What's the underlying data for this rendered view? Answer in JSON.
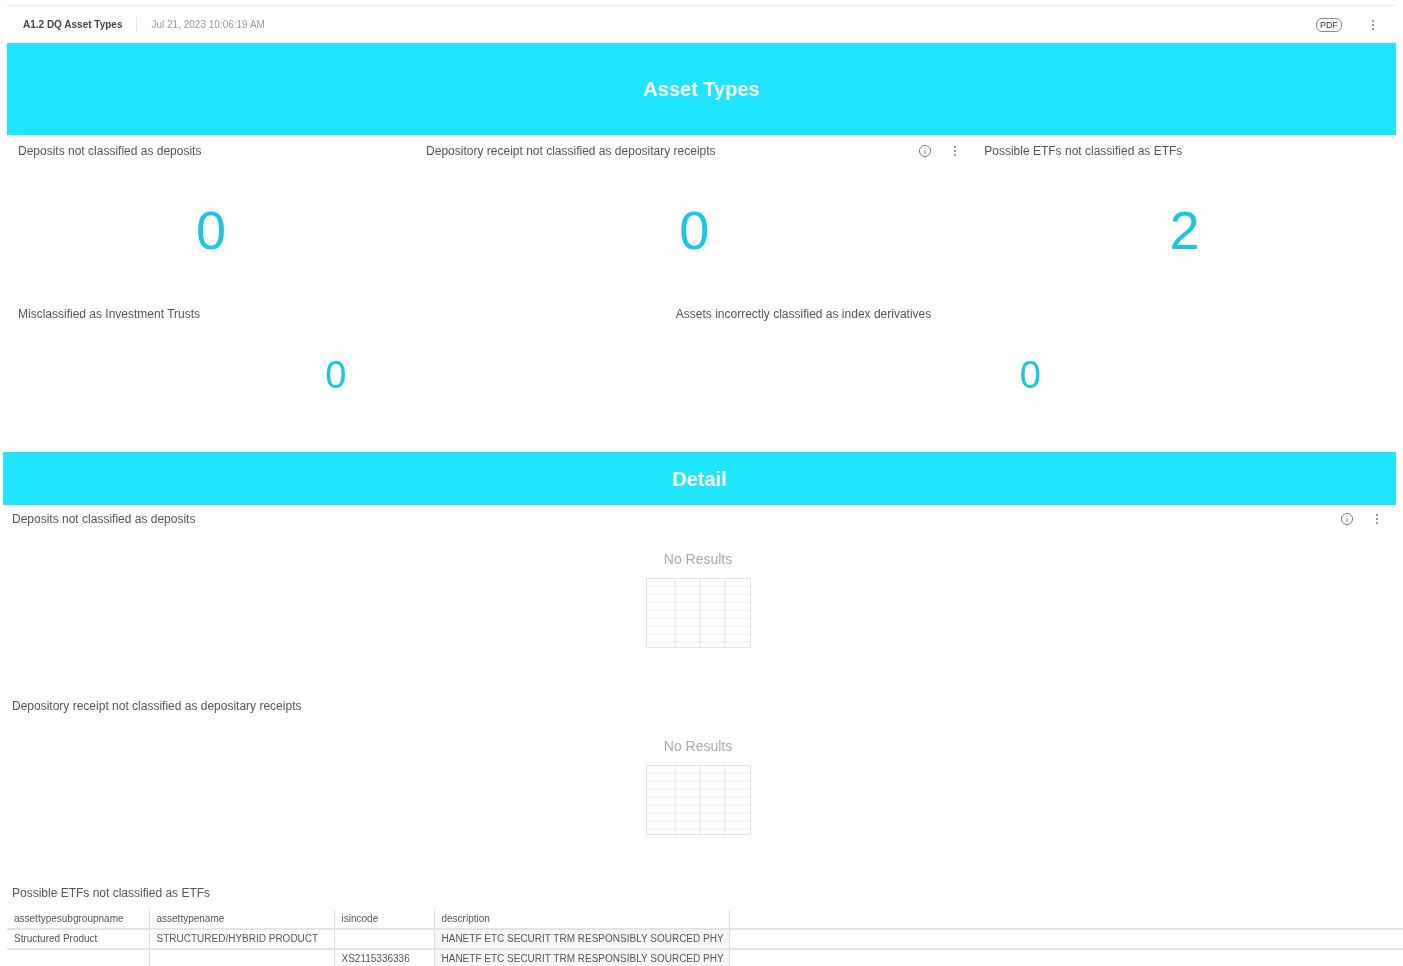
{
  "header": {
    "title": "A1.2 DQ Asset Types",
    "timestamp": "Jul 21, 2023 10:06:19 AM",
    "pdf_label": "PDF"
  },
  "banner": {
    "title": "Asset Types"
  },
  "kpi_rows": [
    {
      "tiles": [
        {
          "title": "Deposits not classified as deposits",
          "value": "0",
          "menu": false
        },
        {
          "title": "Depository receipt not classified as depositary receipts",
          "value": "0",
          "menu": true
        },
        {
          "title": "Possible ETFs not classified as ETFs",
          "value": "2",
          "menu": false
        }
      ]
    },
    {
      "tiles": [
        {
          "title": "Misclassified as Investment Trusts",
          "value": "0",
          "menu": false
        },
        {
          "title": "Assets incorrectly classified as index derivatives",
          "value": "0",
          "menu": false
        }
      ]
    }
  ],
  "detail_banner": {
    "title": "Detail"
  },
  "detail_sections": [
    {
      "kind": "empty",
      "title": "Deposits not classified as deposits",
      "message": "No Results",
      "menu": true
    },
    {
      "kind": "empty",
      "title": "Depository receipt not classified as depositary receipts",
      "message": "No Results",
      "menu": false
    },
    {
      "kind": "table",
      "title": "Possible ETFs not classified as ETFs",
      "menu": false,
      "table": {
        "columns": [
          "assettypesubgroupname",
          "assettypename",
          "isincode",
          "description"
        ],
        "rows": [
          [
            "Structured Product",
            "STRUCTURED/HYBRID PRODUCT",
            "",
            "HANETF ETC SECURIT TRM RESPONSIBLY SOURCED PHY"
          ],
          [
            "",
            "",
            "XS2115336336",
            "HANETF ETC SECURIT TRM RESPONSIBLY SOURCED PHY"
          ]
        ]
      }
    }
  ]
}
